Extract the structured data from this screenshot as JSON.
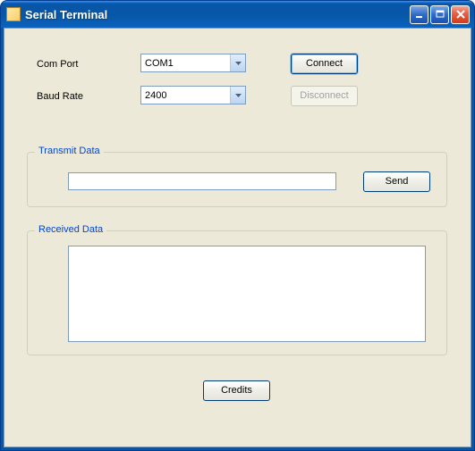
{
  "window": {
    "title": "Serial Terminal"
  },
  "labels": {
    "com_port": "Com Port",
    "baud_rate": "Baud Rate"
  },
  "combos": {
    "com_port_value": "COM1",
    "baud_rate_value": "2400"
  },
  "buttons": {
    "connect": "Connect",
    "disconnect": "Disconnect",
    "send": "Send",
    "credits": "Credits"
  },
  "groups": {
    "transmit": "Transmit Data",
    "received": "Received Data"
  },
  "inputs": {
    "transmit_value": "",
    "received_value": ""
  }
}
